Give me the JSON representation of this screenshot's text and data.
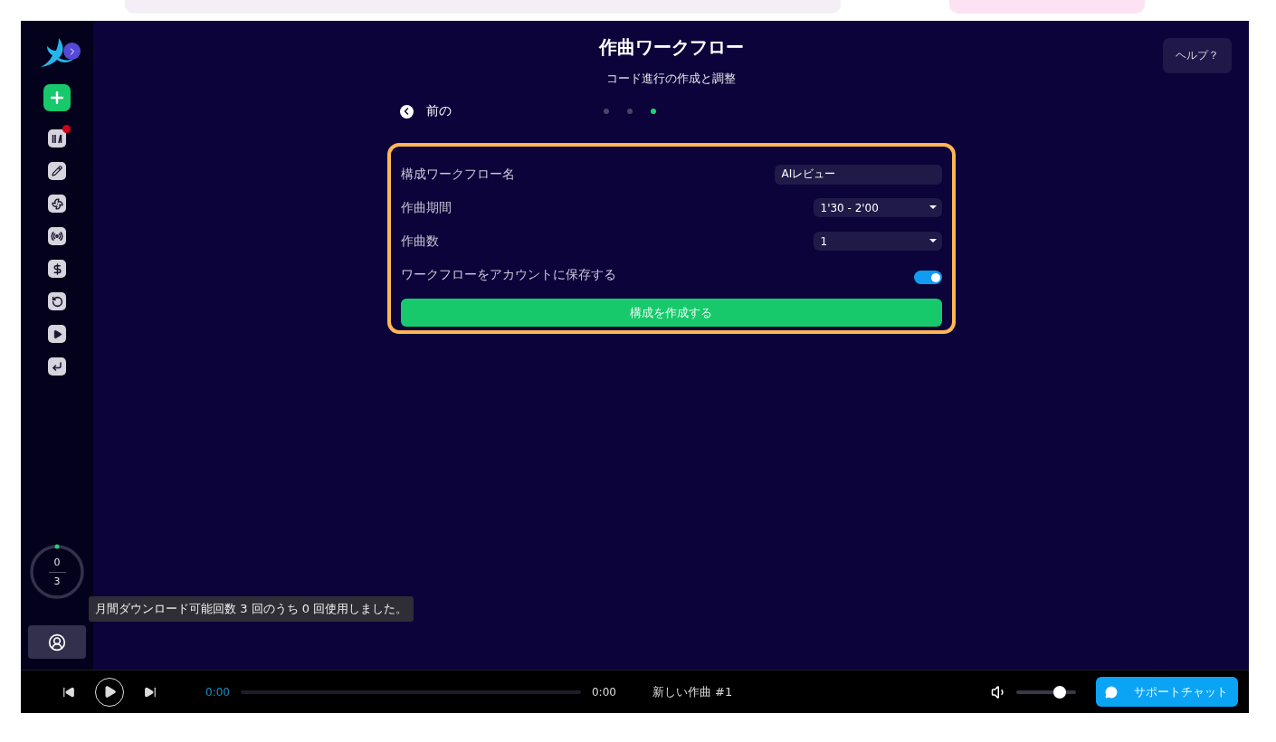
{
  "sidebar": {
    "items": [
      {
        "kind": "create",
        "notification": false
      },
      {
        "kind": "chords",
        "notification": true
      },
      {
        "kind": "edit",
        "notification": false
      },
      {
        "kind": "mix",
        "notification": false
      },
      {
        "kind": "broadcast",
        "notification": false
      },
      {
        "kind": "pricing",
        "notification": false
      },
      {
        "kind": "history",
        "notification": false
      },
      {
        "kind": "play",
        "notification": false
      },
      {
        "kind": "quick",
        "notification": false
      }
    ],
    "usage": {
      "used": "0",
      "total": "3",
      "tooltip": "月間ダウンロード可能回数 3 回のうち 0 回使用しました。"
    }
  },
  "header": {
    "title": "作曲ワークフロー",
    "subtitle": "コード進行の作成と調整",
    "help": "ヘルプ？"
  },
  "stepper": {
    "back": "前の",
    "steps": [
      {
        "selected": false
      },
      {
        "selected": false
      },
      {
        "selected": true
      }
    ]
  },
  "form": {
    "fields": [
      {
        "kind": "text",
        "label": "構成ワークフロー名",
        "value": "AIレビュー"
      },
      {
        "kind": "select",
        "label": "作曲期間",
        "value": "1'30 - 2'00"
      },
      {
        "kind": "select",
        "label": "作曲数",
        "value": "1"
      },
      {
        "kind": "toggle",
        "label": "ワークフローをアカウントに保存する",
        "on": true
      }
    ],
    "submit": "構成を作成する"
  },
  "player": {
    "current": "0:00",
    "duration": "0:00",
    "progress": {
      "level": 0
    },
    "track": "新しい作曲 #1",
    "volume": {
      "level": 0.72
    },
    "support": "サポートチャット"
  }
}
